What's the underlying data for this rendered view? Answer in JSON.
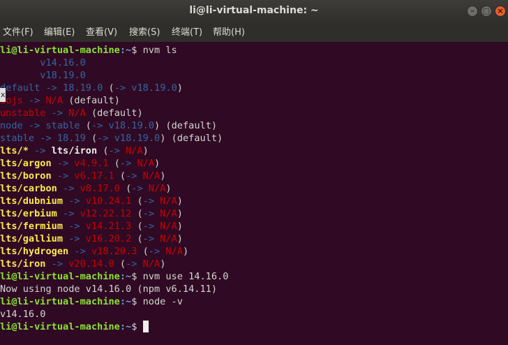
{
  "window": {
    "title": "li@li-virtual-machine: ~",
    "controls": {
      "minimize": "–",
      "maximize": "▢",
      "close": "×"
    }
  },
  "menu": [
    "文件(F)",
    "编辑(E)",
    "查看(V)",
    "搜索(S)",
    "终端(T)",
    "帮助(H)"
  ],
  "side_tab": "x",
  "terminal": {
    "prompt_user_host": "li@li-virtual-machine",
    "prompt_path": ":~",
    "prompt_symbol": "$ ",
    "cmd_nvm_ls": "nvm ls",
    "installed_1": "       v14.16.0",
    "installed_2": "       v18.19.0",
    "default": {
      "name": "default",
      "arrow": " -> ",
      "version": "18.19.0",
      "open": " (",
      "arrow2": "-> ",
      "resolved": "v18.19.0",
      "close": ")"
    },
    "iojs": {
      "name": "iojs",
      "arrow": " -> ",
      "target": "N/A",
      "suffix": " (default)"
    },
    "unstable": {
      "name": "unstable",
      "arrow": " -> ",
      "target": "N/A",
      "suffix": " (default)"
    },
    "node": {
      "name": "node",
      "arrow": " -> ",
      "target": "stable",
      "open": " (",
      "arrow2": "-> ",
      "resolved": "v18.19.0",
      "suffix": ") (default)"
    },
    "stable": {
      "name": "stable",
      "arrow": " -> ",
      "target": "18.19",
      "open": " (",
      "arrow2": "-> ",
      "resolved": "v18.19.0",
      "suffix": ") (default)"
    },
    "lts_star": {
      "name": "lts/*",
      "arrow": " -> ",
      "target": "lts/iron",
      "open": " (",
      "arrow2": "-> ",
      "na": "N/A",
      "close": ")"
    },
    "lts_rows": [
      {
        "name": "lts/argon",
        "arrow": " -> ",
        "version": "v4.9.1",
        "open": " (",
        "arrow2": "-> ",
        "na": "N/A",
        "close": ")"
      },
      {
        "name": "lts/boron",
        "arrow": " -> ",
        "version": "v6.17.1",
        "open": " (",
        "arrow2": "-> ",
        "na": "N/A",
        "close": ")"
      },
      {
        "name": "lts/carbon",
        "arrow": " -> ",
        "version": "v8.17.0",
        "open": " (",
        "arrow2": "-> ",
        "na": "N/A",
        "close": ")"
      },
      {
        "name": "lts/dubnium",
        "arrow": " -> ",
        "version": "v10.24.1",
        "open": " (",
        "arrow2": "-> ",
        "na": "N/A",
        "close": ")"
      },
      {
        "name": "lts/erbium",
        "arrow": " -> ",
        "version": "v12.22.12",
        "open": " (",
        "arrow2": "-> ",
        "na": "N/A",
        "close": ")"
      },
      {
        "name": "lts/fermium",
        "arrow": " -> ",
        "version": "v14.21.3",
        "open": " (",
        "arrow2": "-> ",
        "na": "N/A",
        "close": ")"
      },
      {
        "name": "lts/gallium",
        "arrow": " -> ",
        "version": "v16.20.2",
        "open": " (",
        "arrow2": "-> ",
        "na": "N/A",
        "close": ")"
      },
      {
        "name": "lts/hydrogen",
        "arrow": " -> ",
        "version": "v18.20.3",
        "open": " (",
        "arrow2": "-> ",
        "na": "N/A",
        "close": ")"
      },
      {
        "name": "lts/iron",
        "arrow": " -> ",
        "version": "v20.14.0",
        "open": " (",
        "arrow2": "-> ",
        "na": "N/A",
        "close": ")"
      }
    ],
    "cmd_nvm_use": "nvm use 14.16.0",
    "out_nvm_use": "Now using node v14.16.0 (npm v6.14.11)",
    "cmd_node_v": "node -v",
    "out_node_v": "v14.16.0"
  },
  "colors": {
    "background": "#300a24",
    "prompt_user": "#8ae234",
    "prompt_path": "#729fcf",
    "installed": "#3465a4",
    "not_available": "#cc0000",
    "lts_name": "#fce94f"
  }
}
